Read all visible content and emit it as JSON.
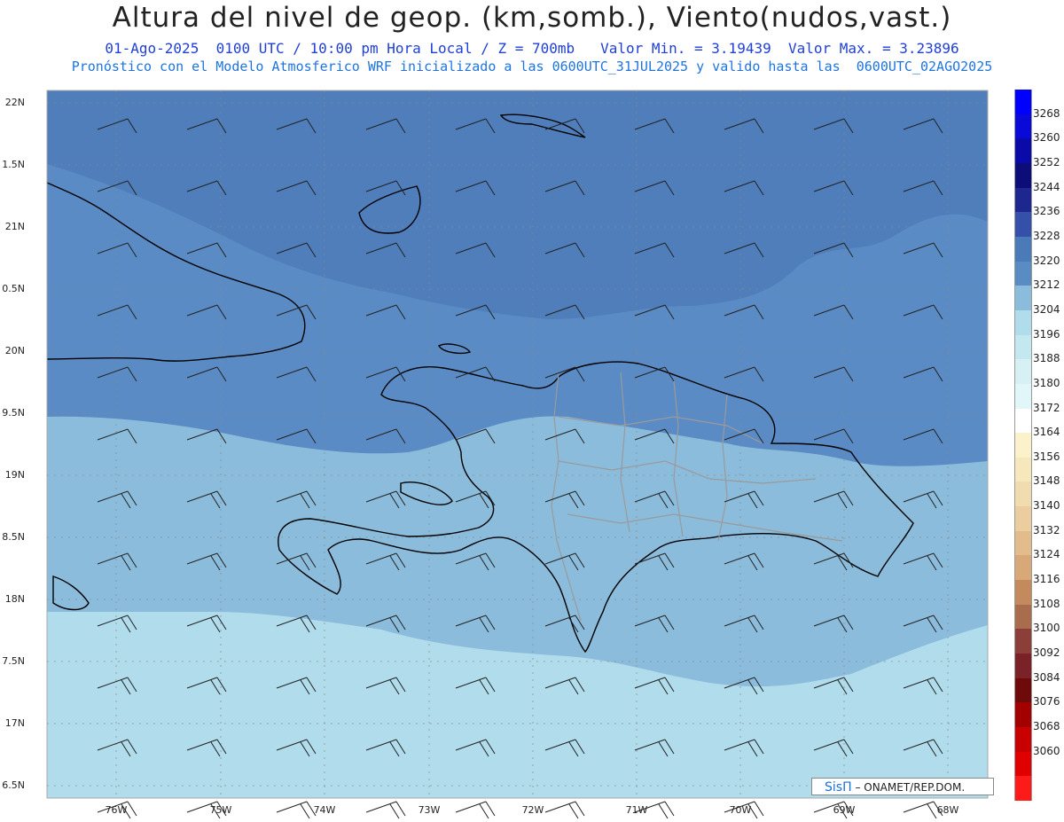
{
  "header": {
    "title": "Altura del nivel de geop. (km,somb.), Viento(nudos,vast.)",
    "line1": "01-Ago-2025  0100 UTC / 10:00 pm Hora Local / Z = 700mb   Valor Min. = 3.19439  Valor Max. = 3.23896",
    "line2": "Pronóstico con el Modelo Atmosferico WRF inicializado a las 0600UTC_31JUL2025 y valido hasta las  0600UTC_02AGO2025"
  },
  "axes": {
    "lat_labels": [
      "22N",
      "1.5N",
      "21N",
      "0.5N",
      "20N",
      "9.5N",
      "19N",
      "8.5N",
      "18N",
      "7.5N",
      "17N",
      "6.5N"
    ],
    "lon_labels": [
      "76W",
      "75W",
      "74W",
      "73W",
      "72W",
      "71W",
      "70W",
      "69W",
      "68W"
    ]
  },
  "colorbar": {
    "labels": [
      "3268",
      "3260",
      "3252",
      "3244",
      "3236",
      "3228",
      "3220",
      "3212",
      "3204",
      "3196",
      "3188",
      "3180",
      "3172",
      "3164",
      "3156",
      "3148",
      "3140",
      "3132",
      "3124",
      "3116",
      "3108",
      "3100",
      "3092",
      "3084",
      "3076",
      "3068",
      "3060"
    ],
    "colors": [
      "#0000ff",
      "#0a0ad8",
      "#0a0aa8",
      "#0d0d7a",
      "#1e2690",
      "#3450a8",
      "#4a7ab8",
      "#5a8cc4",
      "#8cbcdc",
      "#b0dcec",
      "#c4e8f0",
      "#d6f0f4",
      "#e0f6f8",
      "#ffffff",
      "#fbf2cc",
      "#f6e8bc",
      "#f0dcae",
      "#eccda0",
      "#e3bc8c",
      "#d9a878",
      "#c48a5e",
      "#a96c4c",
      "#8c3f38",
      "#7a2228",
      "#6e0a0a",
      "#a30000",
      "#c80000",
      "#e00000",
      "#ff1a1a"
    ]
  },
  "credit": {
    "brand": "SisΠ",
    "text": "– ONAMET/REP.DOM."
  },
  "map_colors": {
    "band_3228": "#4f7ebb",
    "band_3220": "#5b8bc4",
    "band_3212": "#8cbcdc",
    "band_3204": "#b0dcec",
    "band_3196": "#c8ecf2",
    "coast": "#000000",
    "borders": "#9a9a9a"
  }
}
